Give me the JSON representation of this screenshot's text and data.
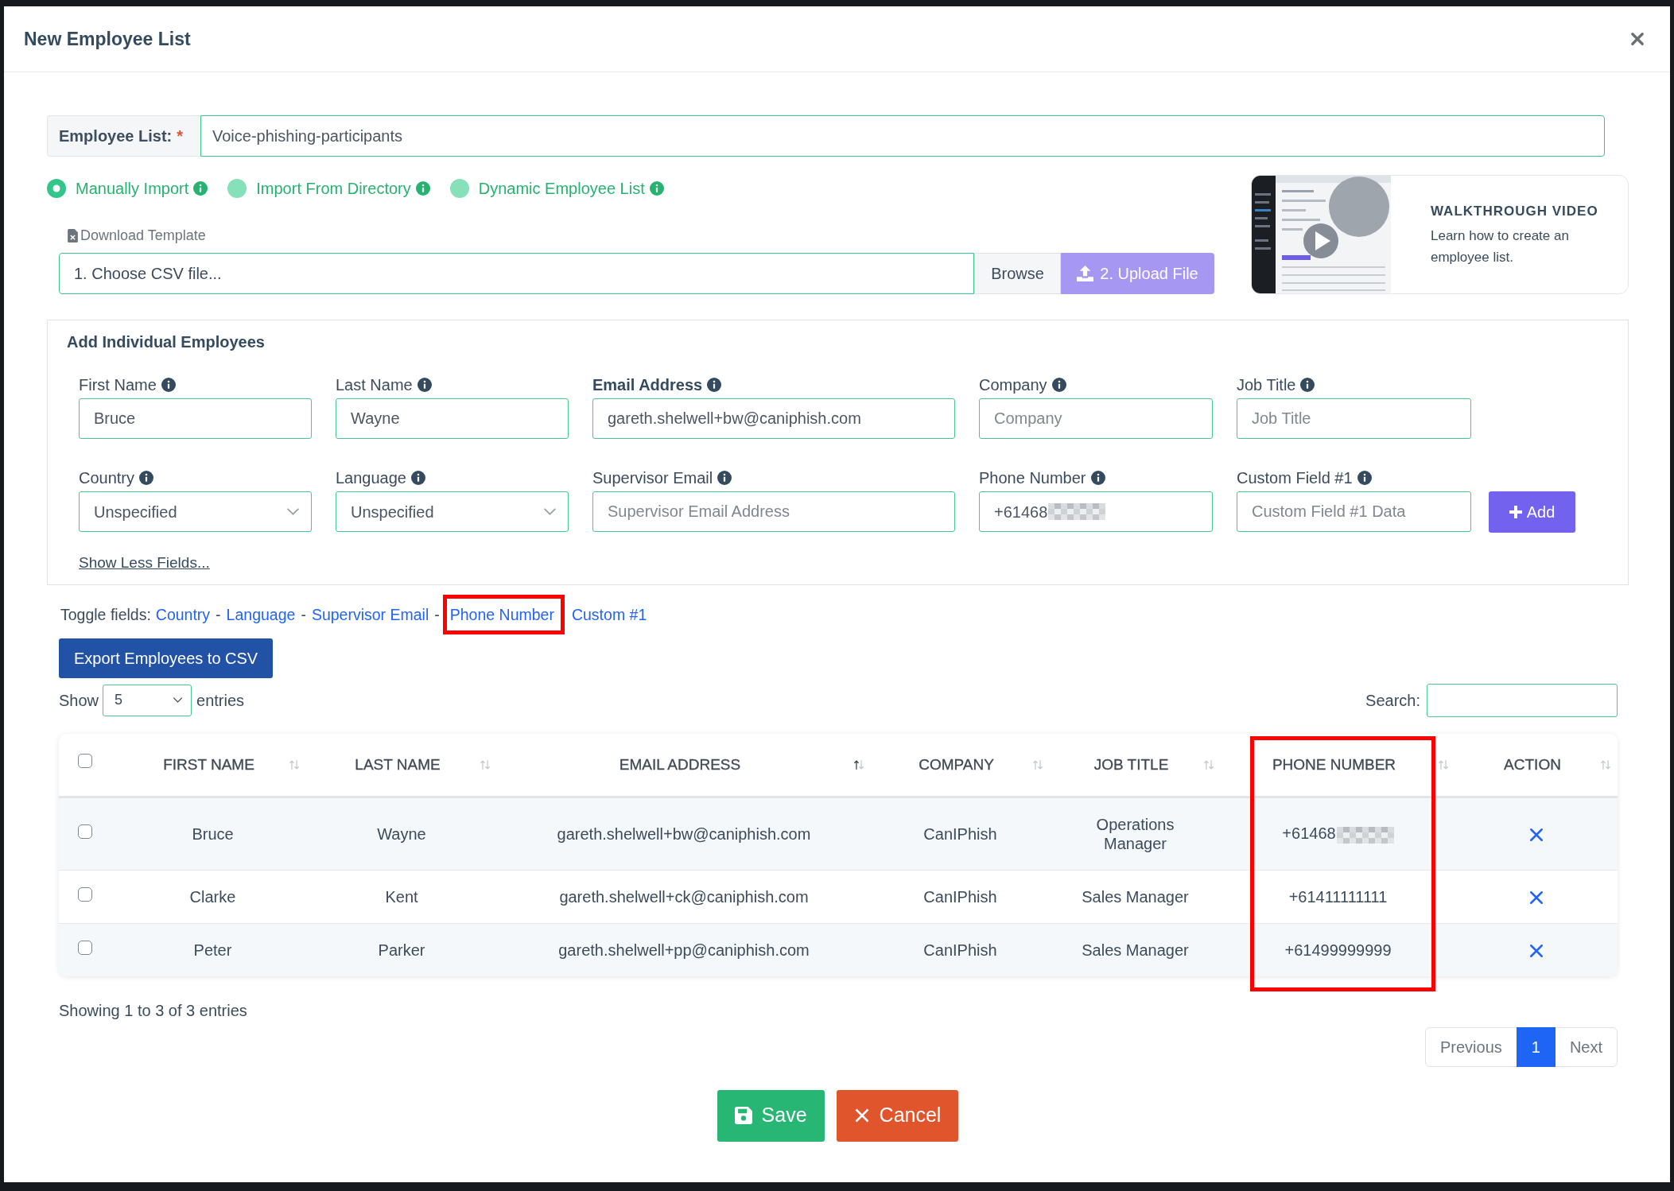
{
  "modal": {
    "title": "New Employee List"
  },
  "employee_list": {
    "label": "Employee List:",
    "required_mark": "*",
    "value": "Voice-phishing-participants"
  },
  "import_modes": [
    {
      "label": "Manually Import",
      "selected": true
    },
    {
      "label": "Import From Directory",
      "selected": false
    },
    {
      "label": "Dynamic Employee List",
      "selected": false
    }
  ],
  "download_template": {
    "label": "Download Template"
  },
  "csv_upload": {
    "file_label": "1. Choose CSV file...",
    "browse_label": "Browse",
    "upload_label": "2. Upload File",
    "upload_disabled": true
  },
  "walkthrough": {
    "title": "WALKTHROUGH VIDEO",
    "text": "Learn how to create an employee list."
  },
  "add_employees": {
    "title": "Add Individual Employees",
    "fields": [
      {
        "label": "First Name",
        "kind": "text",
        "value": "Bruce"
      },
      {
        "label": "Last Name",
        "kind": "text",
        "value": "Wayne"
      },
      {
        "label": "Email Address",
        "kind": "text",
        "value": "gareth.shelwell+bw@caniphish.com",
        "required": true
      },
      {
        "label": "Company",
        "kind": "text",
        "placeholder": "Company"
      },
      {
        "label": "Job Title",
        "kind": "text",
        "placeholder": "Job Title"
      },
      {
        "label": "Country",
        "kind": "select",
        "value": "Unspecified"
      },
      {
        "label": "Language",
        "kind": "select",
        "value": "Unspecified"
      },
      {
        "label": "Supervisor Email",
        "kind": "text",
        "placeholder": "Supervisor Email Address"
      },
      {
        "label": "Phone Number",
        "kind": "text",
        "value": "+61468",
        "redacted": true
      },
      {
        "label": "Custom Field #1",
        "kind": "text",
        "placeholder": "Custom Field #1 Data"
      }
    ],
    "add_label": "Add",
    "show_less": "Show Less Fields..."
  },
  "toggle_fields": {
    "parts": [
      {
        "kind": "label",
        "text": "Toggle fields:"
      },
      {
        "kind": "link",
        "text": "Country",
        "highlighted": false
      },
      {
        "kind": "separator",
        "text": "-"
      },
      {
        "kind": "link",
        "text": "Language",
        "highlighted": false
      },
      {
        "kind": "separator",
        "text": "-"
      },
      {
        "kind": "link",
        "text": "Supervisor Email",
        "highlighted": false
      },
      {
        "kind": "separator",
        "text": "-"
      },
      {
        "kind": "link",
        "text": "Phone Number",
        "highlighted": true
      },
      {
        "kind": "link",
        "text": "Custom #1",
        "highlighted": false
      }
    ]
  },
  "export_button": {
    "label": "Export Employees to CSV"
  },
  "entries": {
    "show_label": "Show",
    "value": "5",
    "suffix": "entries"
  },
  "search": {
    "label": "Search:"
  },
  "table": {
    "header_checked": false,
    "columns": [
      {
        "label": "FIRST NAME",
        "sorted_ascending": false,
        "highlighted": false
      },
      {
        "label": "LAST NAME",
        "sorted_ascending": false,
        "highlighted": false
      },
      {
        "label": "EMAIL ADDRESS",
        "sorted_ascending": true,
        "highlighted": false
      },
      {
        "label": "COMPANY",
        "sorted_ascending": false,
        "highlighted": false
      },
      {
        "label": "JOB TITLE",
        "sorted_ascending": false,
        "highlighted": false
      },
      {
        "label": "PHONE NUMBER",
        "sorted_ascending": false,
        "highlighted": true
      },
      {
        "label": "ACTION",
        "sorted_ascending": false,
        "highlighted": false
      }
    ],
    "rows": [
      {
        "checked": false,
        "first_name": "Bruce",
        "last_name": "Wayne",
        "email": "gareth.shelwell+bw@caniphish.com",
        "company": "CanIPhish",
        "job_title": "Operations Manager",
        "phone": "+61468",
        "phone_redacted": true
      },
      {
        "checked": false,
        "first_name": "Clarke",
        "last_name": "Kent",
        "email": "gareth.shelwell+ck@caniphish.com",
        "company": "CanIPhish",
        "job_title": "Sales Manager",
        "phone": "+61411111111",
        "phone_redacted": false
      },
      {
        "checked": false,
        "first_name": "Peter",
        "last_name": "Parker",
        "email": "gareth.shelwell+pp@caniphish.com",
        "company": "CanIPhish",
        "job_title": "Sales Manager",
        "phone": "+61499999999",
        "phone_redacted": false
      }
    ]
  },
  "info": "Showing 1 to 3 of 3 entries",
  "pagination": [
    {
      "label": "Previous",
      "selected": false,
      "disabled": true
    },
    {
      "label": "1",
      "selected": true,
      "disabled": false
    },
    {
      "label": "Next",
      "selected": false,
      "disabled": true
    }
  ],
  "actions": [
    {
      "kind": "save",
      "label": "Save"
    },
    {
      "kind": "cancel",
      "label": "Cancel"
    }
  ]
}
